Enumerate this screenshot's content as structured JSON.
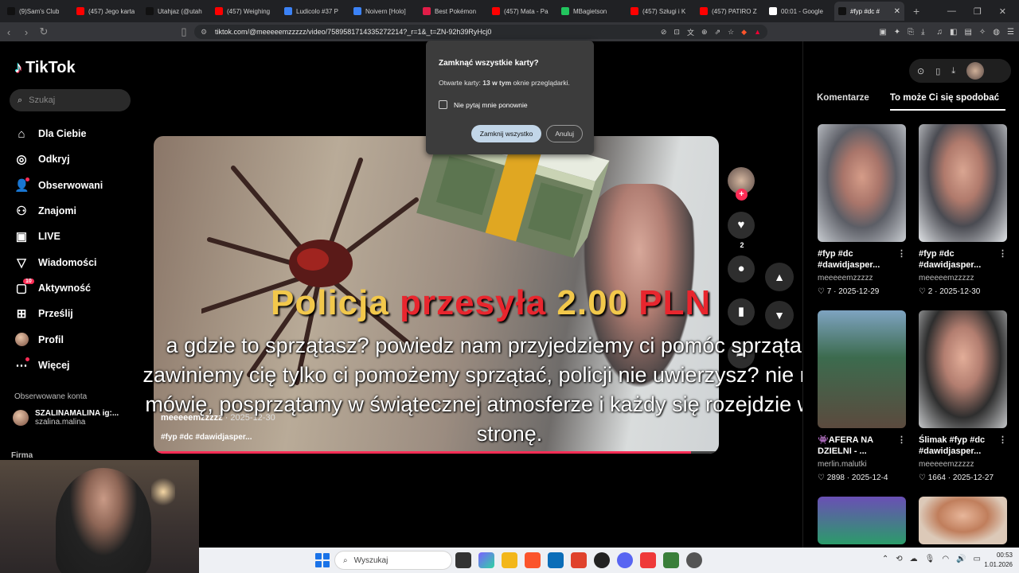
{
  "browser": {
    "tabs": [
      {
        "label": "(9)Sam's Club",
        "color": "#111111"
      },
      {
        "label": "(457) Jego karta",
        "color": "#ff0000"
      },
      {
        "label": "Utahjaz (@utah",
        "color": "#111111"
      },
      {
        "label": "(457) Weighing",
        "color": "#ff0000"
      },
      {
        "label": "Ludicolo #37 P",
        "color": "#3b82f6"
      },
      {
        "label": "Noivern [Holo]",
        "color": "#3b82f6"
      },
      {
        "label": "Best Pokémon",
        "color": "#e11d48"
      },
      {
        "label": "(457) Mata - Pa",
        "color": "#ff0000"
      },
      {
        "label": "MBagietson",
        "color": "#22c55e"
      },
      {
        "label": "(457) Szługi i K",
        "color": "#ff0000"
      },
      {
        "label": "(457) PATIRO Z",
        "color": "#ff0000"
      },
      {
        "label": "00:01 - Google",
        "color": "#ffffff"
      },
      {
        "label": "#fyp #dc #",
        "color": "#111111",
        "active": true
      }
    ],
    "url": "tiktok.com/@meeeeemzzzzz/video/7589581714335272214?_r=1&_t=ZN-92h39RyHcj0"
  },
  "dialog": {
    "title": "Zamknąć wszystkie karty?",
    "text_prefix": "Otwarte karty: ",
    "text_bold": "13 w tym",
    "text_suffix": " oknie przeglądarki.",
    "checkbox": "Nie pytaj mnie ponownie",
    "confirm": "Zamknij wszystko",
    "cancel": "Anuluj"
  },
  "sidebar": {
    "logo": "TikTok",
    "search_placeholder": "Szukaj",
    "items": [
      {
        "label": "Dla Ciebie",
        "icon": "home-icon"
      },
      {
        "label": "Odkryj",
        "icon": "compass-icon"
      },
      {
        "label": "Obserwowani",
        "icon": "following-icon"
      },
      {
        "label": "Znajomi",
        "icon": "friends-icon"
      },
      {
        "label": "LIVE",
        "icon": "live-icon"
      },
      {
        "label": "Wiadomości",
        "icon": "messages-icon"
      },
      {
        "label": "Aktywność",
        "icon": "activity-icon",
        "badge": "10"
      },
      {
        "label": "Prześlij",
        "icon": "upload-icon"
      },
      {
        "label": "Profil",
        "icon": "profile-avatar"
      },
      {
        "label": "Więcej",
        "icon": "more-icon"
      }
    ],
    "followed_header": "Obserwowane konta",
    "followed": {
      "name": "SZALINAMALINA ig:...",
      "handle": "szalina.malina"
    },
    "firma": "Firma"
  },
  "video": {
    "author": "meeeeemzzzzz",
    "date": " · 2025-12-30",
    "tags": "#fyp #dc #dawidjasper...",
    "progress": 0.95,
    "title_words": [
      "Policja",
      "przesyła",
      "2.00",
      "PLN"
    ],
    "subtitle": "a gdzie to sprzątasz? powiedz nam przyjedziemy ci pomóc sprzątać. nie zawiniemy cię tylko ci pomożemy sprzątać, policji nie uwierzysz? nie no serio mówię, posprzątamy w świątecznej atmosferze i każdy się rozejdzie w swoją stronę.",
    "likes": "2"
  },
  "right": {
    "tabs": [
      "Komentarze",
      "To może Ci się spodobać"
    ],
    "cards": [
      {
        "caption": "#fyp #dc #dawidjasper...",
        "author": "meeeeemzzzzz",
        "likes": "7",
        "date": "2025-12-29"
      },
      {
        "caption": "#fyp #dc #dawidjasper...",
        "author": "meeeeemzzzzz",
        "likes": "2",
        "date": "2025-12-30"
      },
      {
        "caption": "👾AFERA NA DZIELNI - ...",
        "author": "merlin.malutki",
        "likes": "2898",
        "date": "2025-12-4"
      },
      {
        "caption": "Ślimak #fyp #dc #dawidjasper...",
        "author": "meeeeemzzzzz",
        "likes": "1664",
        "date": "2025-12-27"
      }
    ]
  },
  "taskbar": {
    "search": "Wyszukaj",
    "time": "00:53",
    "date": "1.01.2026"
  }
}
